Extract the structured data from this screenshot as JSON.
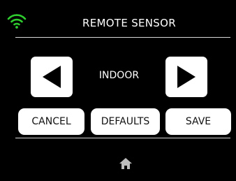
{
  "header": {
    "title": "REMOTE SENSOR",
    "wifi_icon": "wifi-icon",
    "wifi_color": "#2ecc2e"
  },
  "selector": {
    "left_icon": "arrow-left-icon",
    "value": "INDOOR",
    "right_icon": "arrow-right-icon"
  },
  "actions": {
    "cancel_label": "CANCEL",
    "defaults_label": "DEFAULTS",
    "save_label": "SAVE"
  },
  "footer": {
    "home_icon": "home-icon"
  }
}
